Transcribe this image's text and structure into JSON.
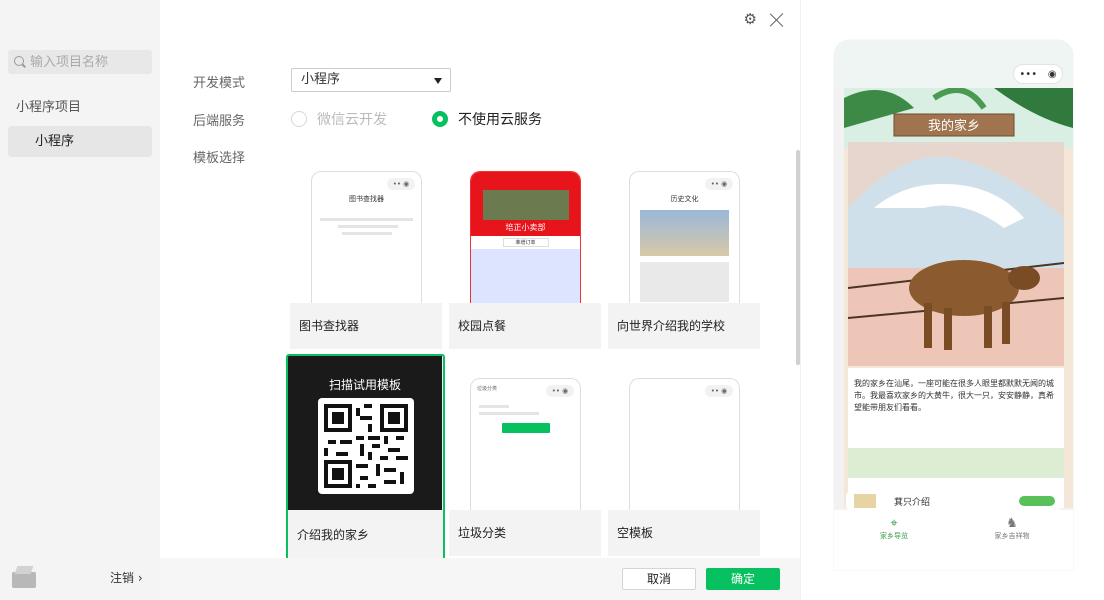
{
  "sidebar": {
    "search_placeholder": "输入项目名称",
    "section_title": "小程序项目",
    "selected_item": "小程序",
    "logout_label": "注销 ›"
  },
  "form": {
    "dev_mode_label": "开发模式",
    "dev_mode_value": "小程序",
    "backend_label": "后端服务",
    "backend_option_cloud": "微信云开发",
    "backend_option_none": "不使用云服务",
    "template_label": "模板选择"
  },
  "templates": [
    {
      "title": "图书查找器",
      "thumb_title": "图书查找器"
    },
    {
      "title": "校园点餐",
      "thumb_title": "培正小卖部",
      "thumb_sub": "莘增订单"
    },
    {
      "title": "向世界介绍我的学校",
      "thumb_title": "历史文化"
    },
    {
      "title": "介绍我的家乡",
      "thumb_title": "扫描试用模板"
    },
    {
      "title": "垃圾分类",
      "thumb_title": "垃圾分类"
    },
    {
      "title": "空模板",
      "thumb_title": ""
    }
  ],
  "buttons": {
    "cancel": "取消",
    "ok": "确定"
  },
  "preview": {
    "banner_title": "我的家乡",
    "paragraph": "我的家乡在汕尾，一座可能在很多人眼里都默默无闻的城市。我最喜欢家乡的大黄牛，很大一只，安安静静，真希望能带朋友们看看。",
    "card_title": "萁只介绍",
    "tabs": [
      "家乡导览",
      "家乡吉祥物"
    ]
  },
  "colors": {
    "accent": "#07c160"
  }
}
